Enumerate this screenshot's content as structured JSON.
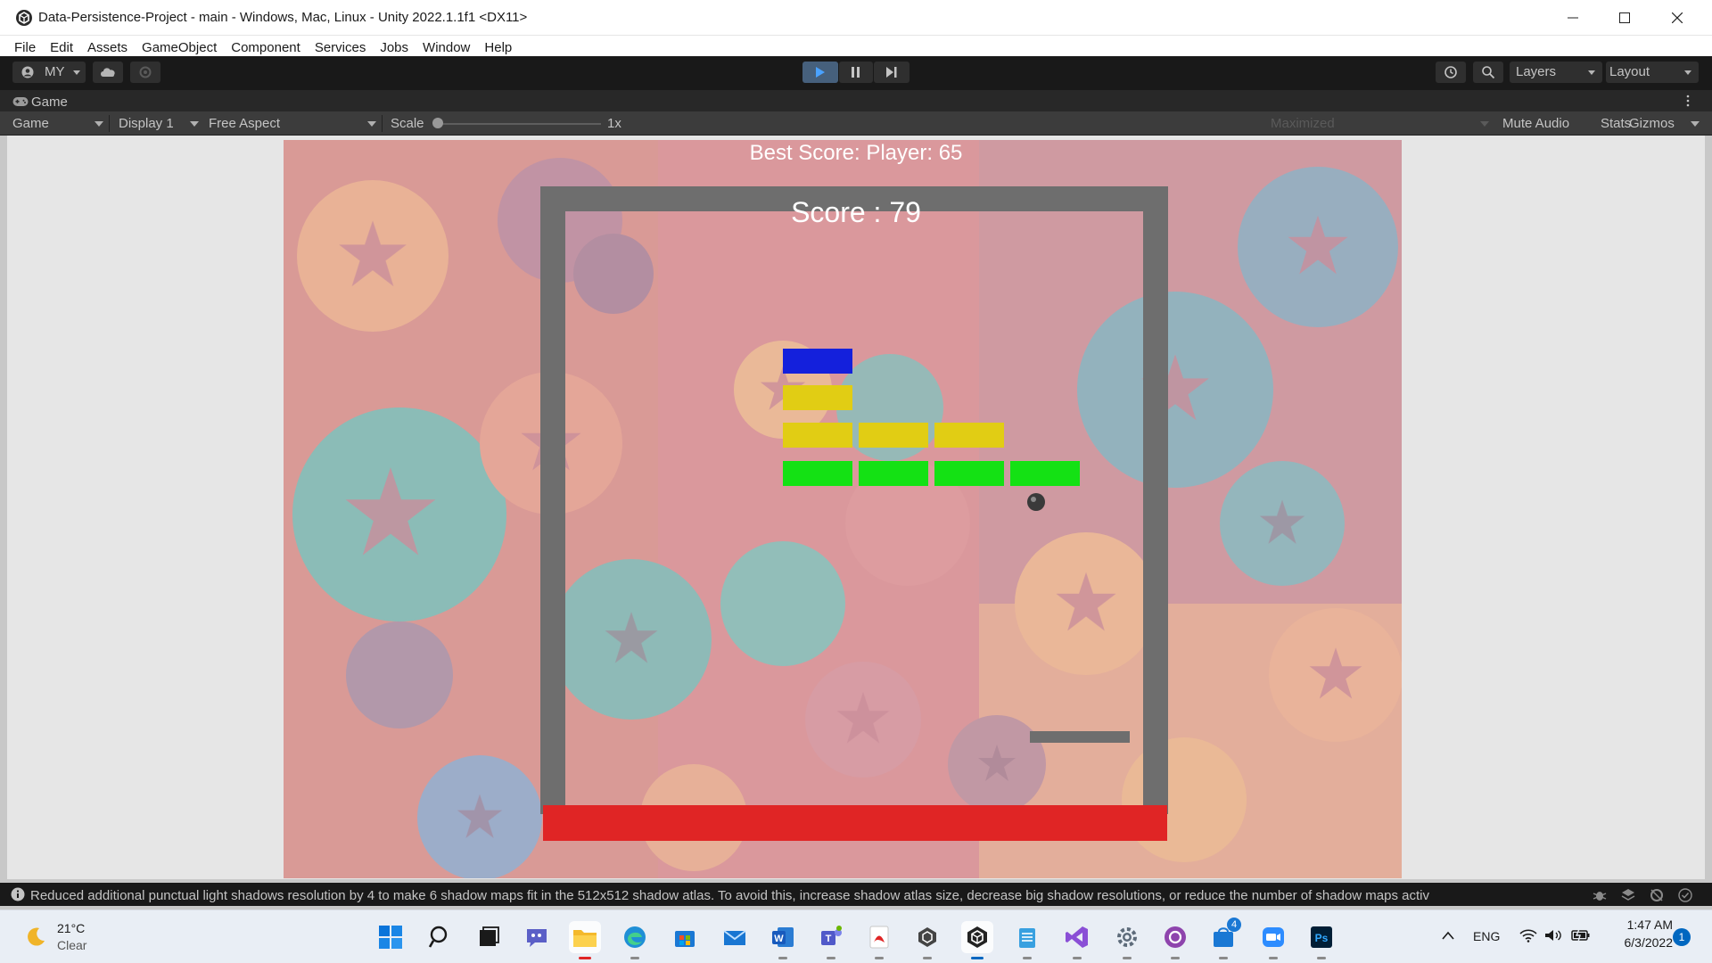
{
  "window": {
    "title": "Data-Persistence-Project - main - Windows, Mac, Linux - Unity 2022.1.1f1 <DX11>",
    "minimize_icon": "minimize-icon",
    "maximize_icon": "maximize-icon",
    "close_icon": "close-icon"
  },
  "menu": [
    "File",
    "Edit",
    "Assets",
    "GameObject",
    "Component",
    "Services",
    "Jobs",
    "Window",
    "Help"
  ],
  "toolbar": {
    "account_label": "MY",
    "layers_label": "Layers",
    "layout_label": "Layout",
    "play_active": true
  },
  "game_tab": {
    "tab_label": "Game",
    "view_select": "Game",
    "display_select": "Display 1",
    "aspect_select": "Free Aspect",
    "scale_label": "Scale",
    "scale_value": "1x",
    "maximized_label": "Maximized",
    "mute_audio_label": "Mute Audio",
    "stats_label": "Stats",
    "gizmos_label": "Gizmos"
  },
  "game": {
    "best_score_text": "Best Score: Player: 65",
    "score_text": "Score : 79",
    "colors": {
      "wall": "#6e6e6e",
      "deadzone": "#e02525",
      "brick_blue": "#1420dc",
      "brick_yellow": "#e1cd14",
      "brick_green": "#14e114",
      "paddle": "#6e6e6e",
      "ball": "#3a3a3a"
    }
  },
  "status": {
    "message": "Reduced additional punctual light shadows resolution by 4 to make 6 shadow maps fit in the 512x512 shadow atlas. To avoid this, increase shadow atlas size, decrease big shadow resolutions, or reduce the number of shadow maps activ"
  },
  "taskbar": {
    "weather_temp": "21°C",
    "weather_desc": "Clear",
    "language": "ENG",
    "time": "1:47 AM",
    "date": "6/3/2022",
    "notification_count": "1",
    "store_badge": "4"
  }
}
